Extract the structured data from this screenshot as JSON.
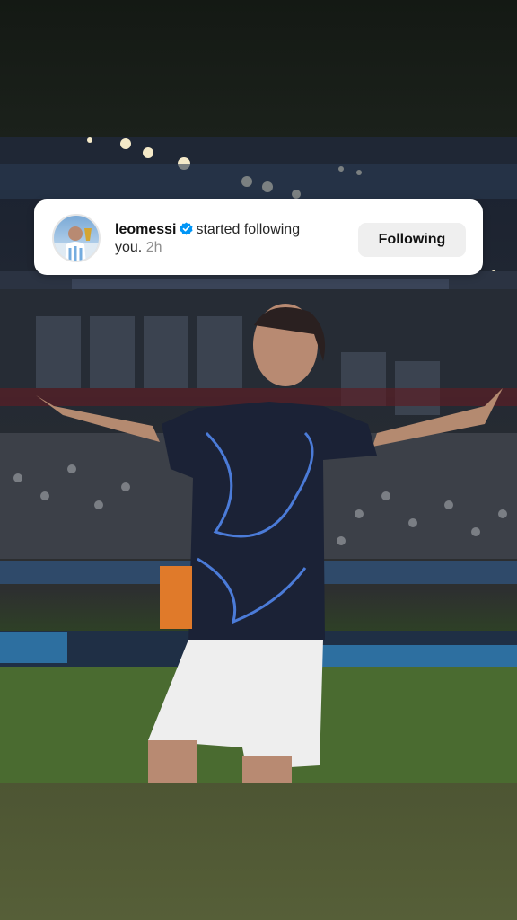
{
  "notification": {
    "username": "leomessi",
    "verified_icon": "verified-badge-icon",
    "action": "started following",
    "line2": "you.",
    "time": "2h",
    "button_label": "Following"
  },
  "colors": {
    "verified": "#0095f6",
    "button_bg": "#efefef",
    "top_band": "#171c17",
    "bottom_band": "#535b36"
  }
}
